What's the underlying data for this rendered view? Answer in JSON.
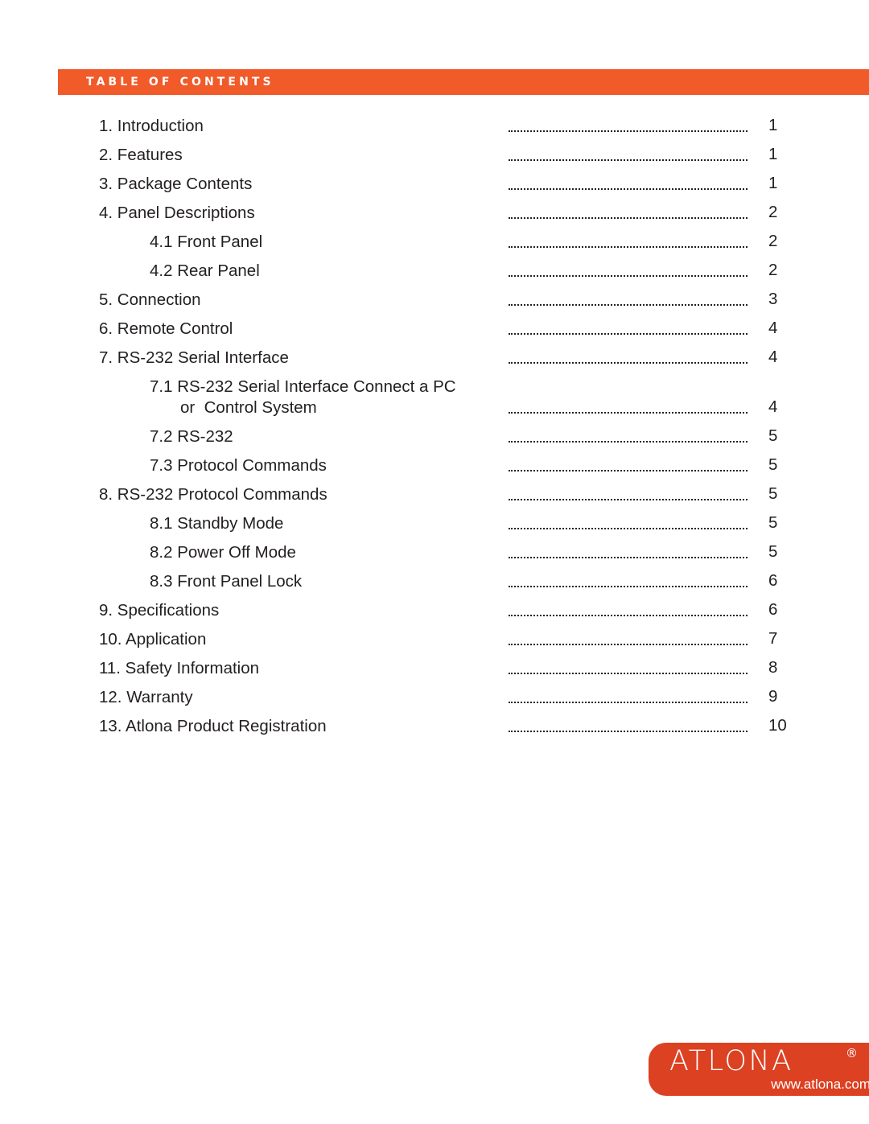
{
  "page": {
    "background_color": "#ffffff",
    "accent_color": "#f15a29",
    "logo_color": "#dc4122",
    "text_color": "#231f20"
  },
  "section_header": {
    "title": "TABLE OF CONTENTS"
  },
  "toc": {
    "entries": [
      {
        "level": 1,
        "label": "1. Introduction",
        "page": "1"
      },
      {
        "level": 1,
        "label": "2. Features",
        "page": "1"
      },
      {
        "level": 1,
        "label": "3. Package Contents",
        "page": "1"
      },
      {
        "level": 1,
        "label": "4. Panel Descriptions",
        "page": "2"
      },
      {
        "level": 2,
        "label": "4.1 Front Panel",
        "page": "2"
      },
      {
        "level": 2,
        "label": "4.2 Rear Panel",
        "page": "2"
      },
      {
        "level": 1,
        "label": "5. Connection",
        "page": "3"
      },
      {
        "level": 1,
        "label": "6. Remote Control",
        "page": "4"
      },
      {
        "level": 1,
        "label": "7. RS-232 Serial Interface",
        "page": "4"
      },
      {
        "level": 2,
        "label": "7.1 RS-232 Serial Interface Connect a PC",
        "label_line2": "or  Control System",
        "page": "4"
      },
      {
        "level": 2,
        "label": "7.2 RS-232",
        "page": "5"
      },
      {
        "level": 2,
        "label": "7.3 Protocol Commands",
        "page": "5"
      },
      {
        "level": 1,
        "label": "8. RS-232 Protocol Commands",
        "page": "5"
      },
      {
        "level": 2,
        "label": "8.1 Standby Mode",
        "page": "5"
      },
      {
        "level": 2,
        "label": "8.2 Power Off Mode",
        "page": "5"
      },
      {
        "level": 2,
        "label": "8.3 Front Panel Lock",
        "page": "6"
      },
      {
        "level": 1,
        "label": "9. Specifications",
        "page": "6"
      },
      {
        "level": 1,
        "label": "10. Application",
        "page": "7"
      },
      {
        "level": 1,
        "label": "11. Safety Information",
        "page": "8"
      },
      {
        "level": 1,
        "label": "12. Warranty",
        "page": "9"
      },
      {
        "level": 1,
        "label": "13. Atlona Product Registration",
        "page": "10"
      }
    ]
  },
  "logo": {
    "wordmark": "ATLONA",
    "registered_mark": "®",
    "url": "www.atlona.com"
  }
}
